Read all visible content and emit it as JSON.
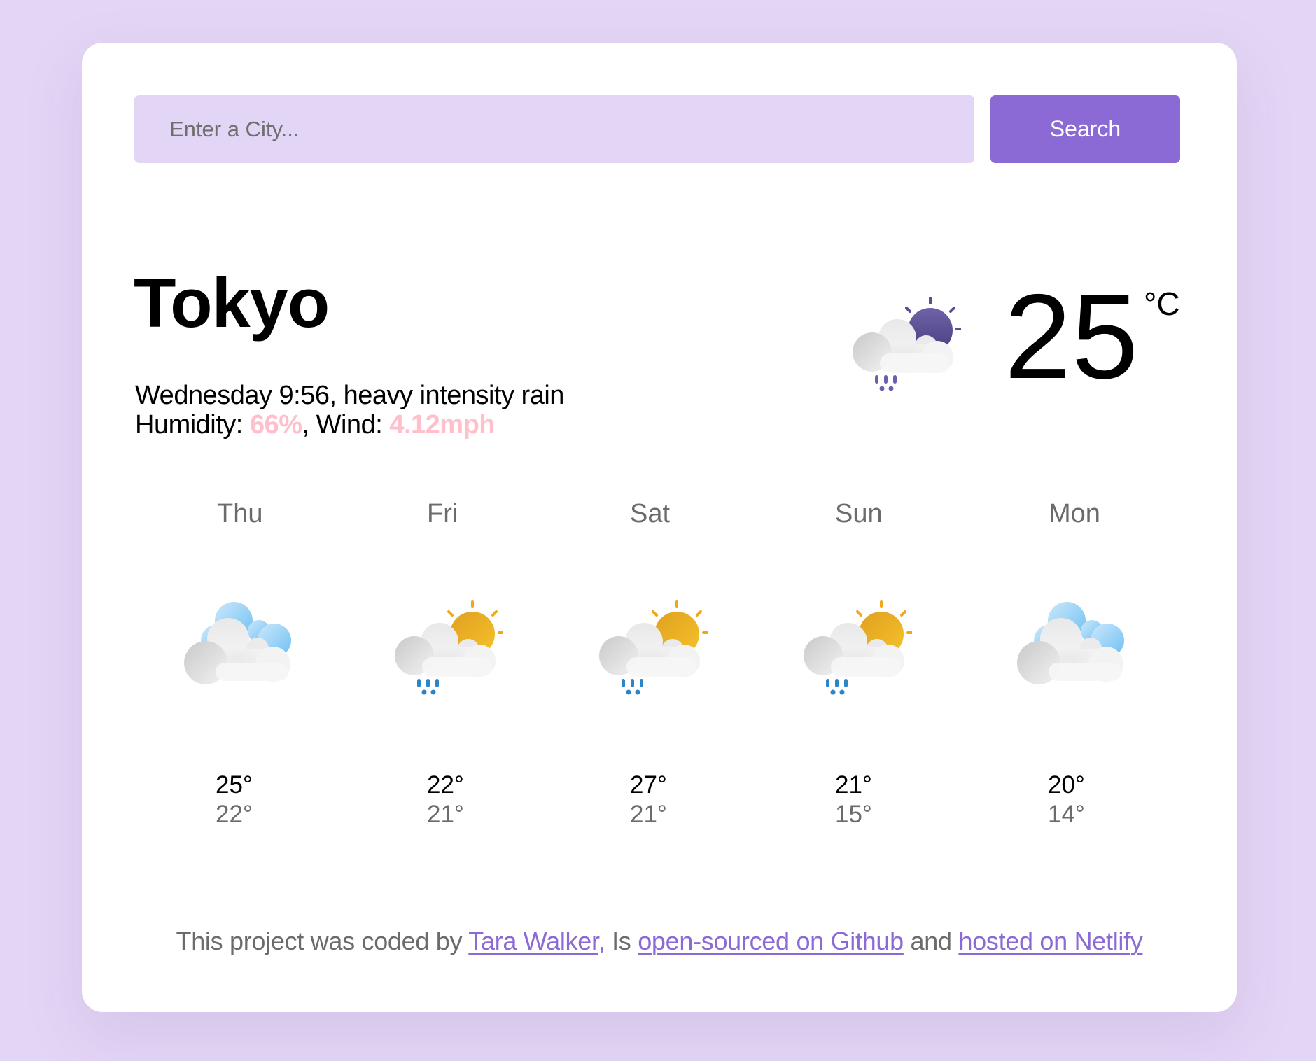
{
  "search": {
    "placeholder": "Enter a City...",
    "value": "",
    "button_label": "Search"
  },
  "current": {
    "city": "Tokyo",
    "day_time": "Wednesday 9:56",
    "description": "heavy intensity rain",
    "humidity_label": "Humidity:",
    "humidity": "66%",
    "wind_label": "Wind:",
    "wind": "4.12mph",
    "temperature": "25",
    "unit": "°C",
    "icon": "rain-sun-night-icon"
  },
  "forecast": [
    {
      "day": "Thu",
      "icon": "broken-clouds-icon",
      "max": "25°",
      "min": "22°"
    },
    {
      "day": "Fri",
      "icon": "rain-sun-icon",
      "max": "22°",
      "min": "21°"
    },
    {
      "day": "Sat",
      "icon": "rain-sun-icon",
      "max": "27°",
      "min": "21°"
    },
    {
      "day": "Sun",
      "icon": "rain-sun-icon",
      "max": "21°",
      "min": "15°"
    },
    {
      "day": "Mon",
      "icon": "broken-clouds-icon",
      "max": "20°",
      "min": "14°"
    }
  ],
  "footer": {
    "text_1": "This project was coded by ",
    "author_link": "Tara Walker",
    "comma": ",",
    "text_2": " Is ",
    "github_link": "open-sourced on Github",
    "text_3": " and ",
    "netlify_link": "hosted on Netlify"
  },
  "colors": {
    "background": "#e3d5f5",
    "accent": "#8c6ad6",
    "highlight": "#ffc0cb",
    "muted_text": "#6b6b6b"
  }
}
